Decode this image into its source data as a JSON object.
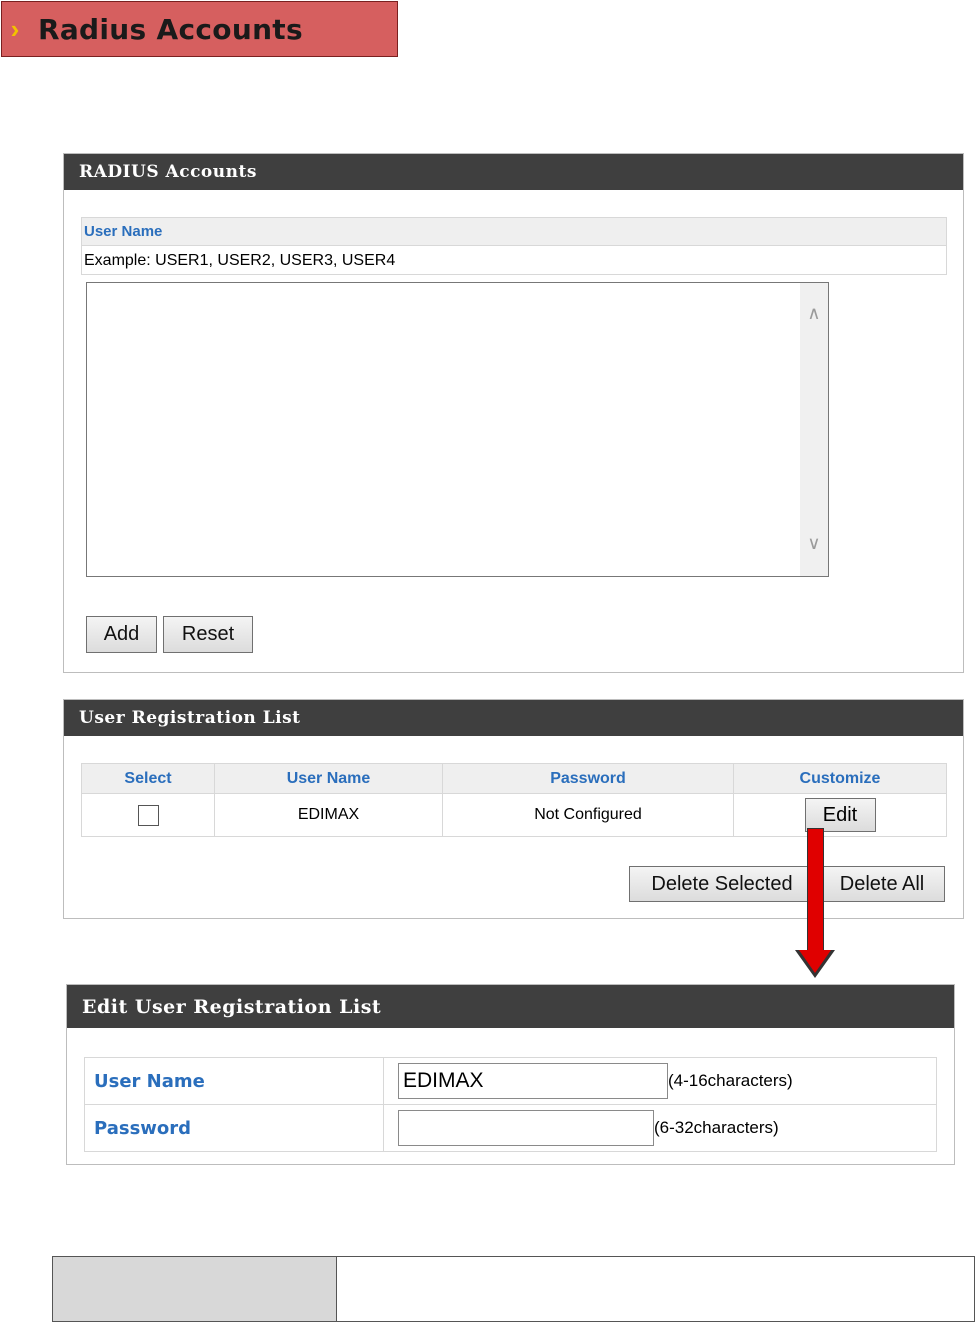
{
  "banner": {
    "title": "Radius Accounts"
  },
  "radius_panel": {
    "title": "RADIUS Accounts",
    "username_header": "User Name",
    "example": "Example: USER1, USER2, USER3, USER4",
    "textarea_value": "",
    "add_label": "Add",
    "reset_label": "Reset"
  },
  "registration_panel": {
    "title": "User Registration List",
    "columns": [
      "Select",
      "User Name",
      "Password",
      "Customize"
    ],
    "rows": [
      {
        "user_name": "EDIMAX",
        "password": "Not Configured",
        "edit_label": "Edit"
      }
    ],
    "delete_selected_label": "Delete Selected",
    "delete_all_label": "Delete All"
  },
  "edit_panel": {
    "title": "Edit User Registration List",
    "username_label": "User Name",
    "username_value": "EDIMAX",
    "username_hint": "(4-16characters)",
    "password_label": "Password",
    "password_value": "",
    "password_hint": "(6-32characters)"
  },
  "colors": {
    "banner_bg": "#d65f5f",
    "panel_header": "#3f3f3f",
    "label_blue": "#2a6ebc",
    "arrow_red": "#e00000"
  }
}
